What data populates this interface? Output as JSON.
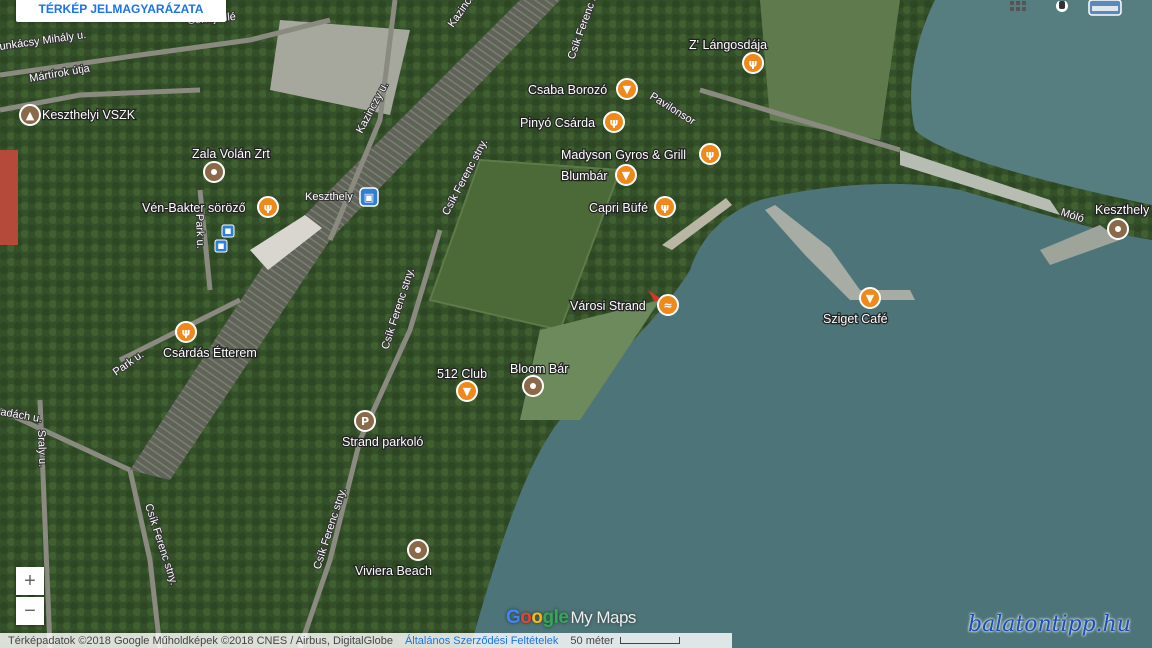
{
  "header": {
    "legend_button": "TÉRKÉP JELMAGYARÁZATA"
  },
  "top_icons": [
    "grid-icon",
    "pegman-icon",
    "layer-thumbnail-icon"
  ],
  "zoom": {
    "in": "+",
    "out": "−"
  },
  "colors": {
    "water": "#4d7478",
    "land": "#3f5a2f",
    "pin_orange": "#f0891c",
    "pin_brown": "#8b6a4a",
    "pin_blue": "#2f7fd3"
  },
  "places": [
    {
      "label": "Keszthelyi VSZK",
      "icon": "graduation-cap-icon",
      "kind": "brown"
    },
    {
      "label": "Zala Volán Zrt",
      "icon": "dot-icon",
      "kind": "brown"
    },
    {
      "label": "Vén-Bakter söröző",
      "icon": "fork-knife-icon",
      "kind": "orange"
    },
    {
      "label": "Csárdás Étterem",
      "icon": "fork-knife-icon",
      "kind": "orange"
    },
    {
      "label": "Keszthely",
      "icon": "train-icon",
      "kind": "blue"
    },
    {
      "label": "Csaba Borozó",
      "icon": "cocktail-icon",
      "kind": "orange"
    },
    {
      "label": "Z' Lángosdája",
      "icon": "fork-knife-icon",
      "kind": "orange"
    },
    {
      "label": "Pinyó Csárda",
      "icon": "fork-knife-icon",
      "kind": "orange"
    },
    {
      "label": "Madyson Gyros & Grill",
      "icon": "fork-knife-icon",
      "kind": "orange"
    },
    {
      "label": "Blumbár",
      "icon": "cocktail-icon",
      "kind": "orange"
    },
    {
      "label": "Capri Büfé",
      "icon": "fork-knife-icon",
      "kind": "orange"
    },
    {
      "label": "Városi Strand",
      "icon": "swimming-icon",
      "kind": "orange"
    },
    {
      "label": "Sziget Café",
      "icon": "cocktail-icon",
      "kind": "orange"
    },
    {
      "label": "Keszthely",
      "icon": "dot-icon",
      "kind": "brown"
    },
    {
      "label": "512 Club",
      "icon": "cocktail-icon",
      "kind": "orange"
    },
    {
      "label": "Bloom Bár",
      "icon": "dot-icon",
      "kind": "brown"
    },
    {
      "label": "Strand parkoló",
      "icon": "parking-icon",
      "kind": "brown"
    },
    {
      "label": "Viviera Beach",
      "icon": "dot-icon",
      "kind": "brown"
    }
  ],
  "streets": [
    "unkácsy Mihály u.",
    "Mártírok útja",
    "Sonaj allé",
    "Kazinczy u.",
    "Kazinczy u.",
    "Csík Ferenc stny.",
    "Csík Ferenc stny.",
    "Csík Ferenc stny.",
    "Csík Ferenc stny.",
    "Csík Ferenc stny.",
    "Park u.",
    "Park u.",
    "adách u.",
    "Sraly u.",
    "Pavilonsor",
    "Móló"
  ],
  "attribution": {
    "text": "Térképadatok ©2018 Google Műholdképek ©2018 CNES / Airbus, DigitalGlobe",
    "terms": "Általános Szerződési Feltételek",
    "scale": "50 méter"
  },
  "logo": {
    "g1": "G",
    "g2": "o",
    "g3": "o",
    "g4": "gle",
    "suffix": "My Maps"
  },
  "watermark": "balatontipp.hu"
}
